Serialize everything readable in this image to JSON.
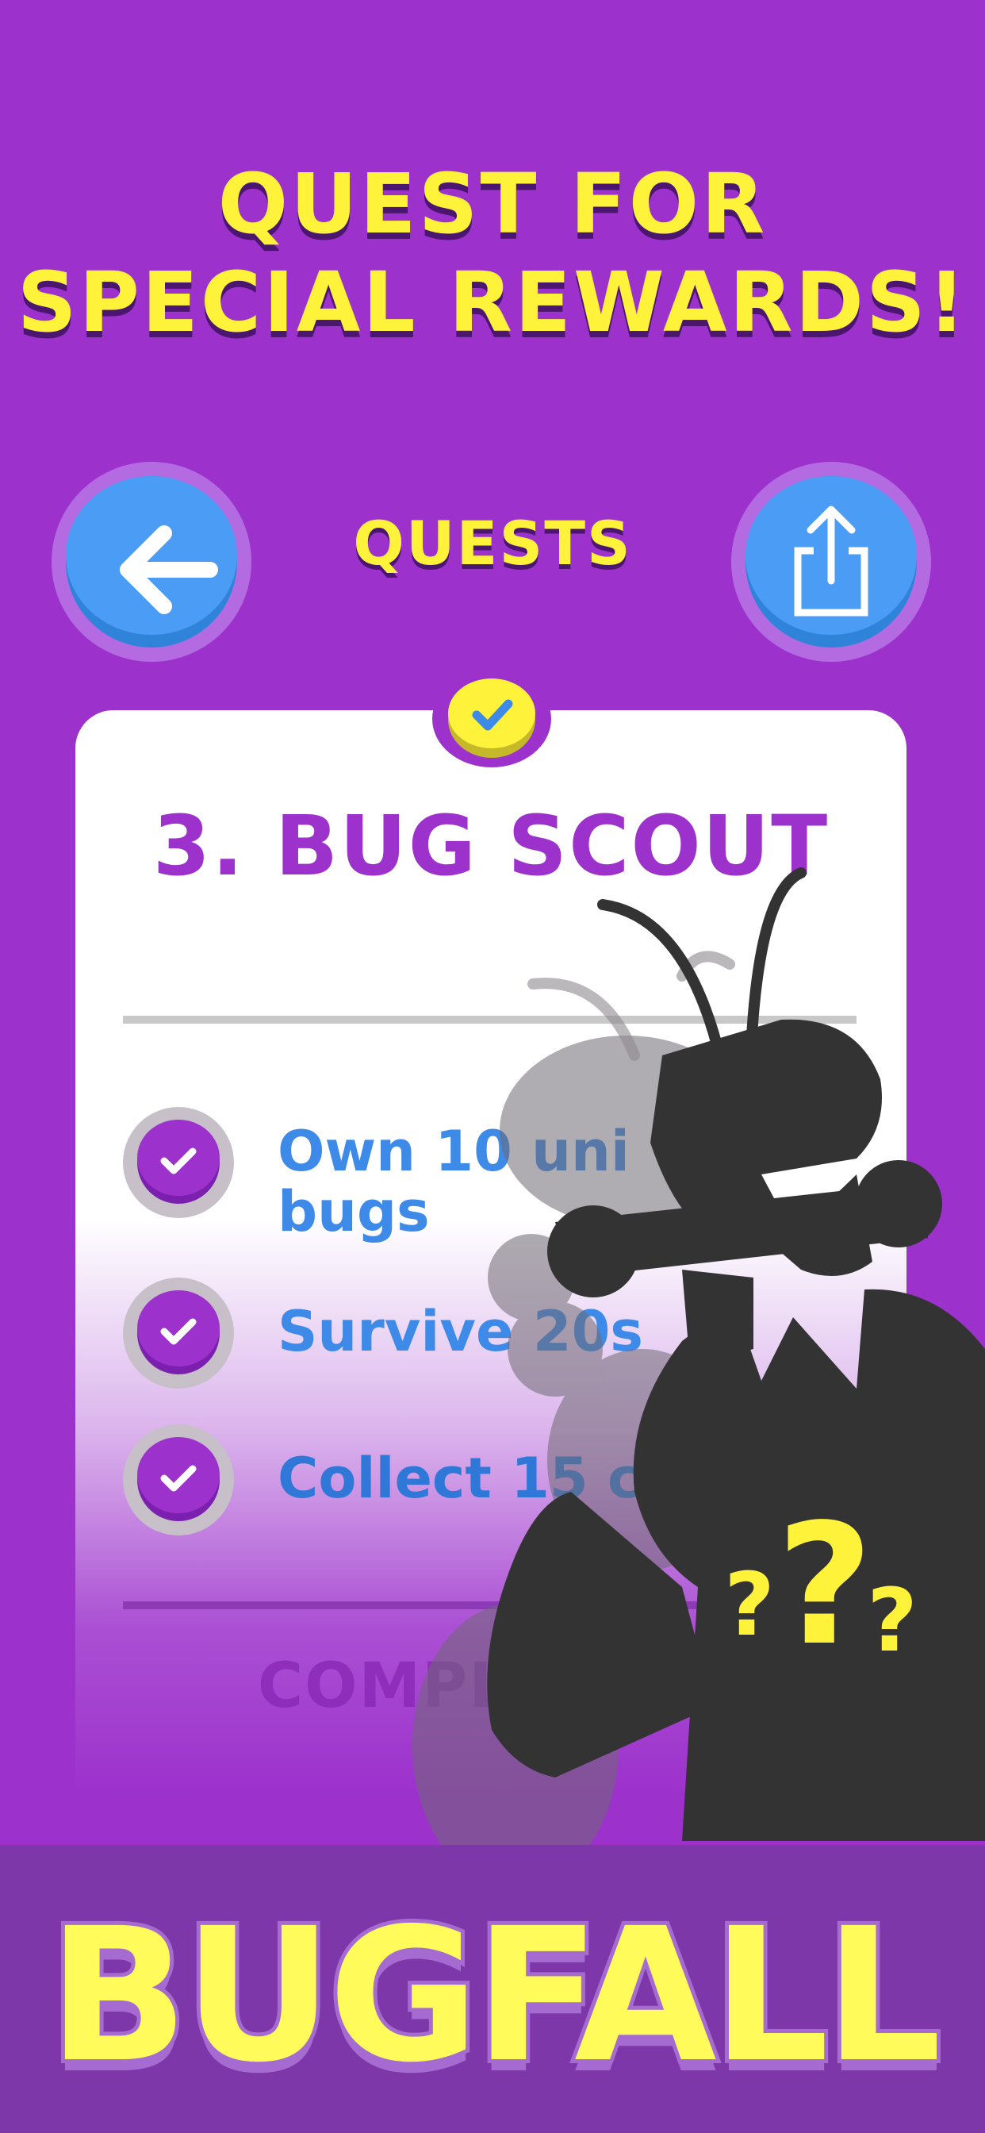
{
  "headline": {
    "line1": "QUEST FOR",
    "line2": "SPECIAL REWARDS!"
  },
  "nav": {
    "title": "QUESTS",
    "back_icon": "arrow-left-icon",
    "share_icon": "share-icon"
  },
  "card": {
    "status_icon": "checkmark-icon",
    "quest_name": "3. BUG SCOUT",
    "tasks": [
      {
        "label": "Own 10 unique bugs",
        "line1": "Own 10 uni",
        "line2": "bugs",
        "completed": true
      },
      {
        "label": "Survive 20s",
        "line1": "Survive 20s",
        "line2": "",
        "completed": true
      },
      {
        "label": "Collect 15 coins",
        "line1": "Collect 15 coin",
        "line2": "",
        "completed": true
      }
    ],
    "status_text": "COMPLETED!"
  },
  "mystery_bug": {
    "icon": "mystery-bug-silhouette",
    "marks": [
      "?",
      "?",
      "?"
    ]
  },
  "brand": {
    "name": "BUGFALL"
  },
  "colors": {
    "background": "#9c31cc",
    "accent_yellow": "#fff23a",
    "button_blue": "#4a9cf5",
    "task_text_blue": "#3d8ae8",
    "bug_silhouette": "#333333"
  }
}
